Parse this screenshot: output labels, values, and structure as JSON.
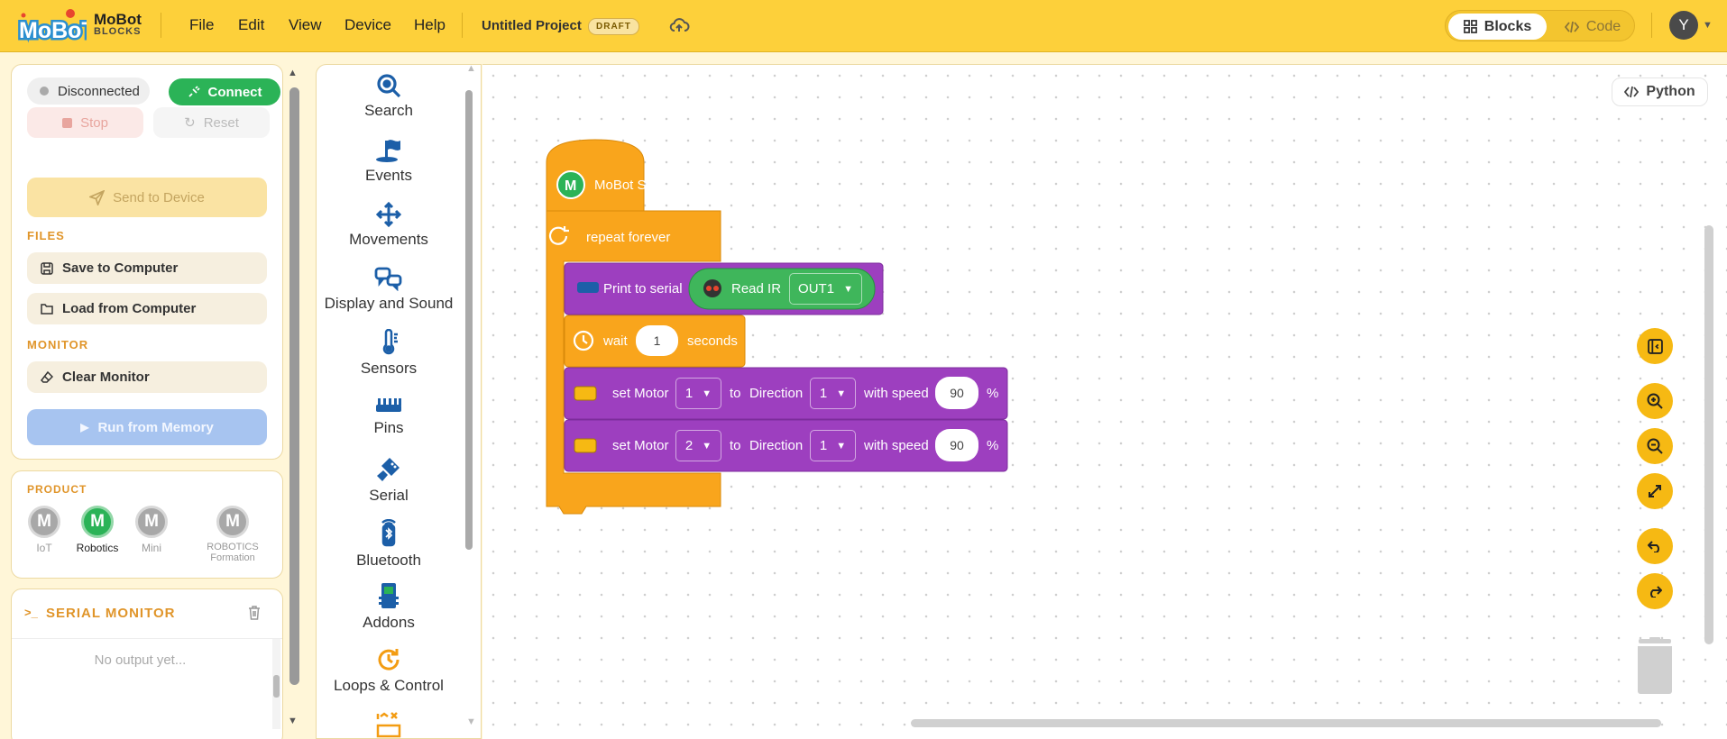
{
  "app": {
    "brand_name": "MoBot",
    "brand_sub": "BLOCKS",
    "logo_text": "MoBoT"
  },
  "menu": [
    "File",
    "Edit",
    "View",
    "Device",
    "Help"
  ],
  "project": {
    "title": "Untitled Project",
    "badge": "DRAFT"
  },
  "view_toggle": {
    "blocks": "Blocks",
    "code": "Code",
    "active": "Blocks"
  },
  "user": {
    "initial": "Y"
  },
  "connection": {
    "status": "Disconnected",
    "connect_label": "Connect"
  },
  "controls": {
    "stop": "Stop",
    "reset": "Reset",
    "send": "Send to Device"
  },
  "files": {
    "heading": "FILES",
    "save": "Save to Computer",
    "load": "Load from Computer"
  },
  "monitor": {
    "heading": "MONITOR",
    "clear": "Clear Monitor",
    "run": "Run from Memory"
  },
  "product": {
    "heading": "PRODUCT",
    "items": [
      {
        "label": "IoT",
        "selected": false
      },
      {
        "label": "Robotics",
        "selected": true
      },
      {
        "label": "Mini",
        "selected": false
      },
      {
        "label": "ROBOTICS Formation",
        "selected": false
      }
    ]
  },
  "serial": {
    "heading": "SERIAL MONITOR",
    "empty": "No output yet..."
  },
  "palette": [
    "Search",
    "Events",
    "Movements",
    "Display and Sound",
    "Sensors",
    "Pins",
    "Serial",
    "Bluetooth",
    "Addons",
    "Loops & Control"
  ],
  "workspace": {
    "python_label": "Python",
    "blocks": {
      "start": "MoBot Start",
      "repeat": "repeat forever",
      "print": "Print to serial",
      "read_ir": "Read IR",
      "read_ir_port": "OUT1",
      "wait": "wait",
      "wait_value": "1",
      "wait_unit": "seconds",
      "motor1": {
        "label": "set Motor",
        "motor": "1",
        "to": "to",
        "direction_label": "Direction",
        "direction": "1",
        "speed_label": "with speed",
        "speed": "90",
        "unit": "%"
      },
      "motor2": {
        "label": "set Motor",
        "motor": "2",
        "to": "to",
        "direction_label": "Direction",
        "direction": "1",
        "speed_label": "with speed",
        "speed": "90",
        "unit": "%"
      }
    }
  },
  "colors": {
    "topbar": "#fdd03a",
    "connect": "#2bb357",
    "control_block": "#f9a51c",
    "action_block": "#9d3fbf",
    "sensor_block": "#3fb65b",
    "accent": "#e0952a"
  }
}
